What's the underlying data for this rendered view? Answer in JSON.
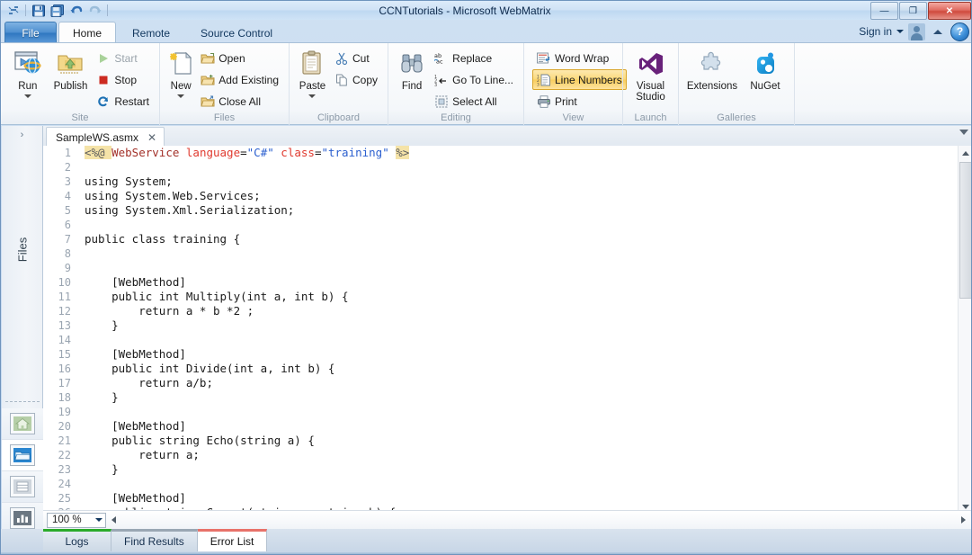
{
  "window": {
    "title": "CCNTutorials - Microsoft WebMatrix",
    "quick_access": [
      {
        "name": "app-menu-icon",
        "glyph": "⌗"
      },
      {
        "name": "save-icon",
        "glyph": "💾"
      },
      {
        "name": "save-all-icon",
        "glyph": "🖫"
      },
      {
        "name": "undo-icon",
        "glyph": "↶"
      },
      {
        "name": "redo-icon",
        "glyph": "↷"
      }
    ],
    "controls": {
      "minimize": "—",
      "maximize": "❐",
      "close": "✕"
    }
  },
  "ribbon": {
    "file_tab": "File",
    "tabs": [
      {
        "label": "Home",
        "active": true
      },
      {
        "label": "Remote",
        "active": false
      },
      {
        "label": "Source Control",
        "active": false
      }
    ],
    "signin": {
      "label": "Sign in",
      "help": "?"
    },
    "groups": [
      {
        "title": "Site",
        "big": [
          {
            "label": "Run",
            "icon": "run-icon",
            "split": true
          },
          {
            "label": "Publish",
            "icon": "publish-icon",
            "split": false
          }
        ],
        "small": [
          {
            "label": "Start",
            "icon": "start-icon",
            "disabled": true
          },
          {
            "label": "Stop",
            "icon": "stop-icon",
            "disabled": false
          },
          {
            "label": "Restart",
            "icon": "restart-icon",
            "disabled": false
          }
        ]
      },
      {
        "title": "Files",
        "big": [
          {
            "label": "New",
            "icon": "new-file-icon",
            "split": true
          }
        ],
        "small": [
          {
            "label": "Open",
            "icon": "open-folder-icon",
            "disabled": false
          },
          {
            "label": "Add Existing",
            "icon": "add-existing-icon",
            "disabled": false
          },
          {
            "label": "Close All",
            "icon": "close-all-icon",
            "disabled": false
          }
        ]
      },
      {
        "title": "Clipboard",
        "big": [
          {
            "label": "Paste",
            "icon": "paste-icon",
            "split": true
          }
        ],
        "small": [
          {
            "label": "Cut",
            "icon": "cut-icon",
            "disabled": false
          },
          {
            "label": "Copy",
            "icon": "copy-icon",
            "disabled": false
          }
        ]
      },
      {
        "title": "Editing",
        "big": [
          {
            "label": "Find",
            "icon": "find-binoculars-icon",
            "split": false
          }
        ],
        "small": [
          {
            "label": "Replace",
            "icon": "replace-icon",
            "disabled": false
          },
          {
            "label": "Go To Line...",
            "icon": "go-to-line-icon",
            "disabled": false
          },
          {
            "label": "Select All",
            "icon": "select-all-icon",
            "disabled": false
          }
        ]
      },
      {
        "title": "View",
        "big": [],
        "small": [
          {
            "label": "Word Wrap",
            "icon": "word-wrap-icon",
            "disabled": false
          },
          {
            "label": "Line Numbers",
            "icon": "line-numbers-icon",
            "disabled": false,
            "toggled": true
          },
          {
            "label": "Print",
            "icon": "print-icon",
            "disabled": false
          }
        ]
      },
      {
        "title": "Launch",
        "big": [
          {
            "label": "Visual\nStudio",
            "icon": "visual-studio-icon",
            "split": false
          }
        ],
        "small": []
      },
      {
        "title": "Galleries",
        "big": [
          {
            "label": "Extensions",
            "icon": "extensions-puzzle-icon",
            "split": false
          },
          {
            "label": "NuGet",
            "icon": "nuget-icon",
            "split": false
          }
        ],
        "small": []
      }
    ]
  },
  "sidebar": {
    "expand_glyph": "›",
    "label": "Files",
    "icons": [
      {
        "name": "sidebar-icon-site",
        "selected": false
      },
      {
        "name": "sidebar-icon-files",
        "selected": true
      },
      {
        "name": "sidebar-icon-databases",
        "selected": false
      },
      {
        "name": "sidebar-icon-reports",
        "selected": false
      }
    ]
  },
  "editor": {
    "tab": {
      "label": "SampleWS.asmx",
      "close": "✕"
    },
    "lines": [
      {
        "n": "1",
        "tokens": [
          {
            "t": "<%@ ",
            "c": "tk-dir"
          },
          {
            "t": "WebService ",
            "c": "tk-tag"
          },
          {
            "t": "language",
            "c": "tk-attr"
          },
          {
            "t": "=",
            "c": "tk-eq"
          },
          {
            "t": "\"C#\"",
            "c": "tk-val"
          },
          {
            "t": " ",
            "c": "tk-eq"
          },
          {
            "t": "class",
            "c": "tk-attr"
          },
          {
            "t": "=",
            "c": "tk-eq"
          },
          {
            "t": "\"training\"",
            "c": "tk-val"
          },
          {
            "t": " ",
            "c": "tk-eq"
          },
          {
            "t": "%>",
            "c": "tk-dir"
          }
        ]
      },
      {
        "n": "2",
        "text": ""
      },
      {
        "n": "3",
        "text": "using System;"
      },
      {
        "n": "4",
        "text": "using System.Web.Services;"
      },
      {
        "n": "5",
        "text": "using System.Xml.Serialization;"
      },
      {
        "n": "6",
        "text": ""
      },
      {
        "n": "7",
        "text": "public class training {"
      },
      {
        "n": "8",
        "text": ""
      },
      {
        "n": "9",
        "text": ""
      },
      {
        "n": "10",
        "text": "    [WebMethod]"
      },
      {
        "n": "11",
        "text": "    public int Multiply(int a, int b) {"
      },
      {
        "n": "12",
        "text": "        return a * b *2 ;"
      },
      {
        "n": "13",
        "text": "    }"
      },
      {
        "n": "14",
        "text": ""
      },
      {
        "n": "15",
        "text": "    [WebMethod]"
      },
      {
        "n": "16",
        "text": "    public int Divide(int a, int b) {"
      },
      {
        "n": "17",
        "text": "        return a/b;"
      },
      {
        "n": "18",
        "text": "    }"
      },
      {
        "n": "19",
        "text": ""
      },
      {
        "n": "20",
        "text": "    [WebMethod]"
      },
      {
        "n": "21",
        "text": "    public string Echo(string a) {"
      },
      {
        "n": "22",
        "text": "        return a;"
      },
      {
        "n": "23",
        "text": "    }"
      },
      {
        "n": "24",
        "text": ""
      },
      {
        "n": "25",
        "text": "    [WebMethod]"
      },
      {
        "n": "26",
        "text": "    public string Concat(string a, string b) {"
      }
    ]
  },
  "statusbar": {
    "zoom": "100 %"
  },
  "bottom_tabs": [
    {
      "label": "Logs",
      "accent": "#2bab2b",
      "active": false
    },
    {
      "label": "Find Results",
      "accent": "#9aa7b4",
      "active": false
    },
    {
      "label": "Error List",
      "accent": "#e8726a",
      "active": true
    }
  ],
  "colors": {
    "ribbon_accent": "#2f77c0",
    "toggle_amber": "#f8cd5c",
    "error_red": "#e8726a",
    "log_green": "#2bab2b"
  }
}
